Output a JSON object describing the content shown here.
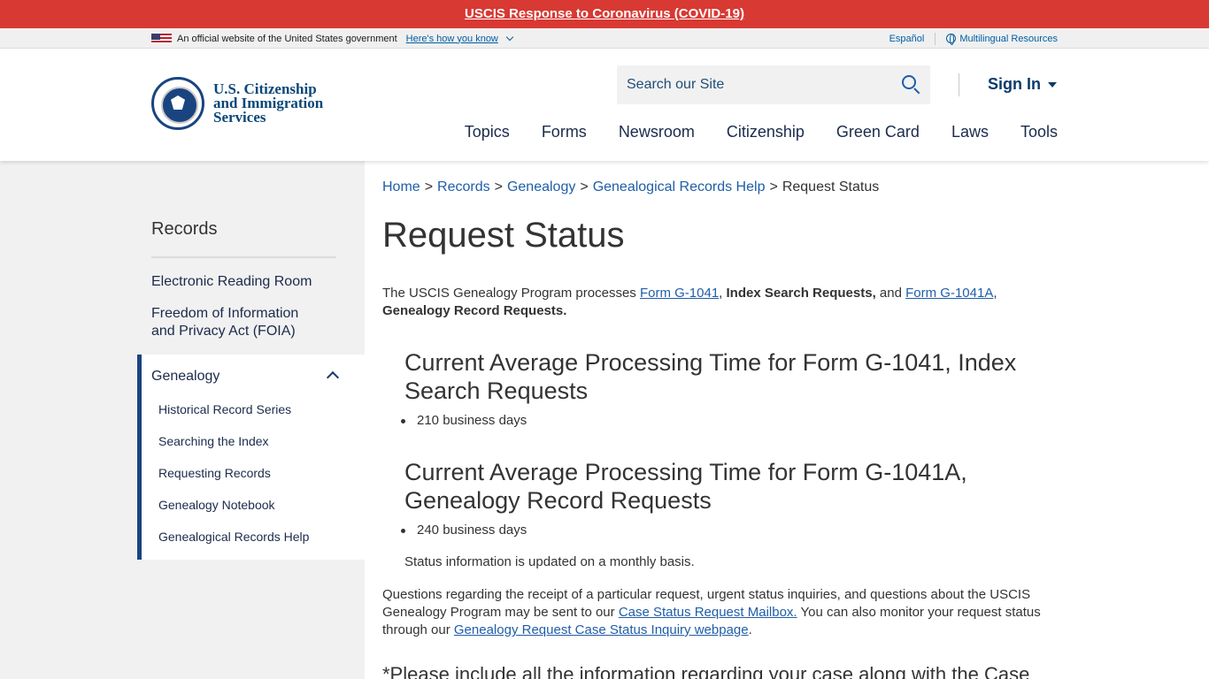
{
  "alert": {
    "text": "USCIS Response to Coronavirus (COVID-19)"
  },
  "gov_banner": {
    "official": "An official website of the United States government",
    "hows": "Here's how you know",
    "espanol": "Español",
    "multilingual": "Multilingual Resources"
  },
  "header": {
    "logo_line1": "U.S. Citizenship",
    "logo_line2": "and Immigration",
    "logo_line3": "Services",
    "search_placeholder": "Search our Site",
    "signin": "Sign In",
    "nav": [
      "Topics",
      "Forms",
      "Newsroom",
      "Citizenship",
      "Green Card",
      "Laws",
      "Tools"
    ]
  },
  "sidebar": {
    "title": "Records",
    "links": [
      "Electronic Reading Room",
      "Freedom of Information",
      "and Privacy Act (FOIA)"
    ],
    "group": "Genealogy",
    "sub": [
      "Historical Record Series",
      "Searching the Index",
      "Requesting Records",
      "Genealogy Notebook",
      "Genealogical Records Help"
    ]
  },
  "breadcrumb": {
    "items": [
      "Home",
      "Records",
      "Genealogy",
      "Genealogical Records Help"
    ],
    "sep": ">",
    "current": "Request Status"
  },
  "page": {
    "title": "Request Status",
    "intro_1": "The USCIS Genealogy Program processes ",
    "intro_link1": "Form G-1041",
    "intro_comma": ", ",
    "intro_b1": "Index Search Requests,",
    "intro_and": " and ",
    "intro_link2": "Form G-1041A",
    "intro_comma2": ", ",
    "intro_b2": "Genealogy Record Requests.",
    "h2_1": "Current Average Processing Time for Form G-1041, Index Search Requests",
    "bullet_1": "210 business days",
    "h2_2": "Current Average Processing Time for Form G-1041A, Genealogy Record Requests",
    "bullet_2": "240 business days",
    "note": "Status information is updated on a monthly basis.",
    "q_1": "Questions regarding the receipt of a particular request, urgent status inquiries, and questions about the USCIS Genealogy Program may be sent to our ",
    "q_link1": "Case Status Request Mailbox.",
    "q_2": " You can also monitor your request status through our ",
    "q_link2": "Genealogy Request Case Status Inquiry webpage",
    "q_3": ".",
    "partial": "*Please include all the information regarding your case along with the Case"
  }
}
